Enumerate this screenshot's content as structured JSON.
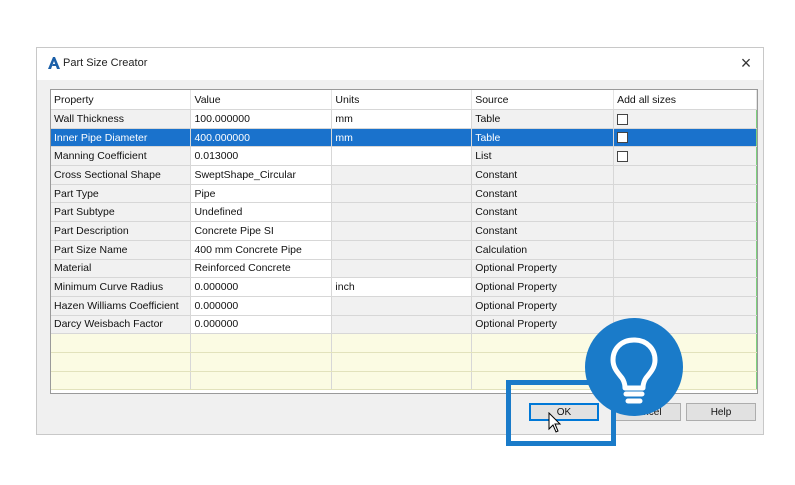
{
  "window": {
    "title": "Part Size Creator",
    "close_glyph": "×",
    "icon": "civil3d-a-icon"
  },
  "grid": {
    "columns": [
      "Property",
      "Value",
      "Units",
      "Source",
      "Add all sizes"
    ],
    "rows": [
      {
        "property": "Wall Thickness",
        "value": "100.000000",
        "units": "mm",
        "source": "Table",
        "checkbox": true
      },
      {
        "property": "Inner Pipe Diameter",
        "value": "400.000000",
        "units": "mm",
        "source": "Table",
        "checkbox": true,
        "selected": true
      },
      {
        "property": "Manning Coefficient",
        "value": "0.013000",
        "units": "",
        "source": "List",
        "checkbox": true
      },
      {
        "property": "Cross Sectional Shape",
        "value": "SweptShape_Circular",
        "units": "",
        "source": "Constant"
      },
      {
        "property": "Part Type",
        "value": "Pipe",
        "units": "",
        "source": "Constant"
      },
      {
        "property": "Part Subtype",
        "value": "Undefined",
        "units": "",
        "source": "Constant"
      },
      {
        "property": "Part Description",
        "value": "Concrete Pipe SI",
        "units": "",
        "source": "Constant"
      },
      {
        "property": "Part Size Name",
        "value": "400 mm Concrete Pipe",
        "units": "",
        "source": "Calculation"
      },
      {
        "property": "Material",
        "value": "Reinforced Concrete",
        "units": "",
        "source": "Optional Property"
      },
      {
        "property": "Minimum Curve Radius",
        "value": "0.000000",
        "units": "inch",
        "source": "Optional Property"
      },
      {
        "property": "Hazen Williams Coefficient",
        "value": "0.000000",
        "units": "",
        "source": "Optional Property"
      },
      {
        "property": "Darcy Weisbach Factor",
        "value": "0.000000",
        "units": "",
        "source": "Optional Property"
      }
    ]
  },
  "buttons": {
    "ok": "OK",
    "cancel": "Cancel",
    "help": "Help"
  },
  "overlay": {
    "badge_icon": "lightbulb-icon",
    "accent_color": "#1a7bc9"
  }
}
